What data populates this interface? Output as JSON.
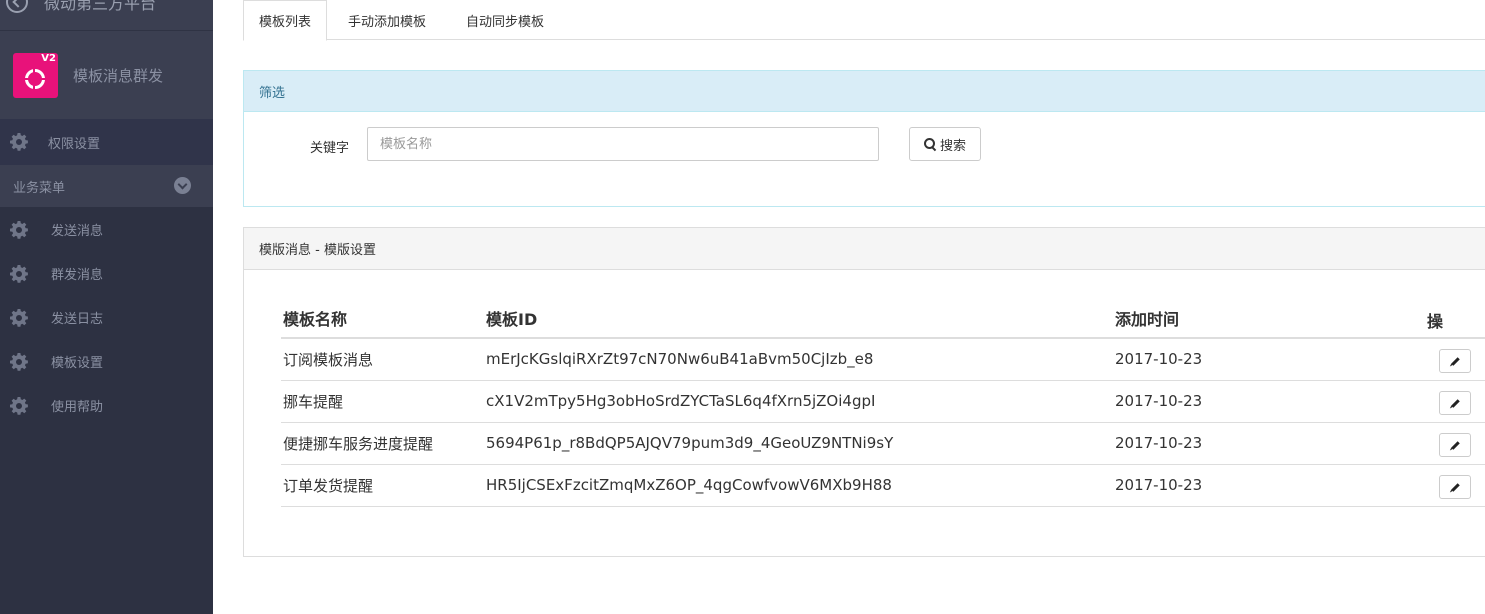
{
  "sidebar": {
    "top_text": "微动第三方平台",
    "brand": {
      "title": "模板消息群发",
      "logo_badge": "V2"
    },
    "permission": {
      "label": "权限设置"
    },
    "section": {
      "label": "业务菜单"
    },
    "items": [
      {
        "label": "发送消息",
        "icon": "gear-icon"
      },
      {
        "label": "群发消息",
        "icon": "gear-icon"
      },
      {
        "label": "发送日志",
        "icon": "gear-icon"
      },
      {
        "label": "模板设置",
        "icon": "gear-icon"
      },
      {
        "label": "使用帮助",
        "icon": "gear-icon"
      }
    ]
  },
  "tabs": [
    {
      "label": "模板列表",
      "active": true
    },
    {
      "label": "手动添加模板",
      "active": false
    },
    {
      "label": "自动同步模板",
      "active": false
    }
  ],
  "filter": {
    "heading": "筛选",
    "keyword_label": "关键字",
    "keyword_value": "",
    "keyword_placeholder": "模板名称",
    "search_label": "搜索"
  },
  "list": {
    "heading": "模版消息 - 模版设置",
    "columns": {
      "name": "模板名称",
      "id": "模板ID",
      "time": "添加时间",
      "op": "操"
    },
    "rows": [
      {
        "name": "订阅模板消息",
        "id": "mErJcKGslqiRXrZt97cN70Nw6uB41aBvm50CjIzb_e8",
        "time": "2017-10-23"
      },
      {
        "name": "挪车提醒",
        "id": "cX1V2mTpy5Hg3obHoSrdZYCTaSL6q4fXrn5jZOi4gpI",
        "time": "2017-10-23"
      },
      {
        "name": "便捷挪车服务进度提醒",
        "id": "5694P61p_r8BdQP5AJQV79pum3d9_4GeoUZ9NTNi9sY",
        "time": "2017-10-23"
      },
      {
        "name": "订单发货提醒",
        "id": "HR5IjCSExFzcitZmqMxZ6OP_4qgCowfvowV6MXb9H88",
        "time": "2017-10-23"
      }
    ]
  },
  "colors": {
    "sidebar_bg": "#2d3142",
    "brand_logo": "#e8127a",
    "filter_heading_bg": "#d9edf7",
    "filter_heading_text": "#31708f"
  }
}
